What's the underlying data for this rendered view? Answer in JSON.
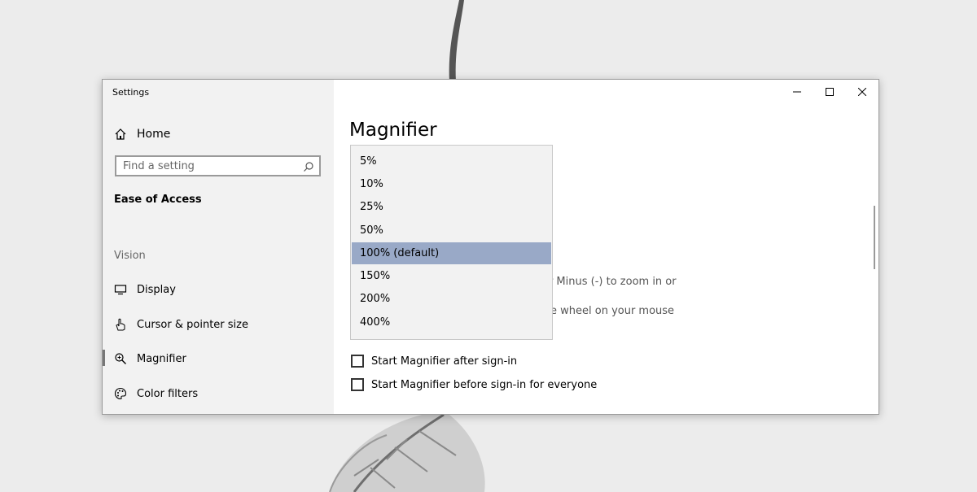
{
  "window": {
    "title": "Settings",
    "controls": [
      {
        "icon": "minimize-icon"
      },
      {
        "icon": "maximize-icon"
      },
      {
        "icon": "close-icon"
      }
    ]
  },
  "sidebar": {
    "home_label": "Home",
    "search_placeholder": "Find a setting",
    "section_title": "Ease of Access",
    "group_title": "Vision",
    "items": [
      {
        "label": "Display",
        "icon": "monitor-icon"
      },
      {
        "label": "Cursor & pointer size",
        "icon": "pointer-hand-icon"
      },
      {
        "label": "Magnifier",
        "icon": "magnifier-icon",
        "selected": true
      },
      {
        "label": "Color filters",
        "icon": "palette-icon"
      }
    ]
  },
  "main": {
    "title": "Magnifier",
    "partial_text_1": "or Minus (-) to zoom in or",
    "partial_text_2": "e wheel on your mouse",
    "checkboxes": [
      {
        "label": "Start Magnifier after sign-in",
        "checked": false
      },
      {
        "label": "Start Magnifier before sign-in for everyone",
        "checked": false
      }
    ]
  },
  "dropdown": {
    "options": [
      "5%",
      "10%",
      "25%",
      "50%",
      "100% (default)",
      "150%",
      "200%",
      "400%"
    ],
    "selected": "100% (default)",
    "selected_color": "#99a9c7"
  }
}
